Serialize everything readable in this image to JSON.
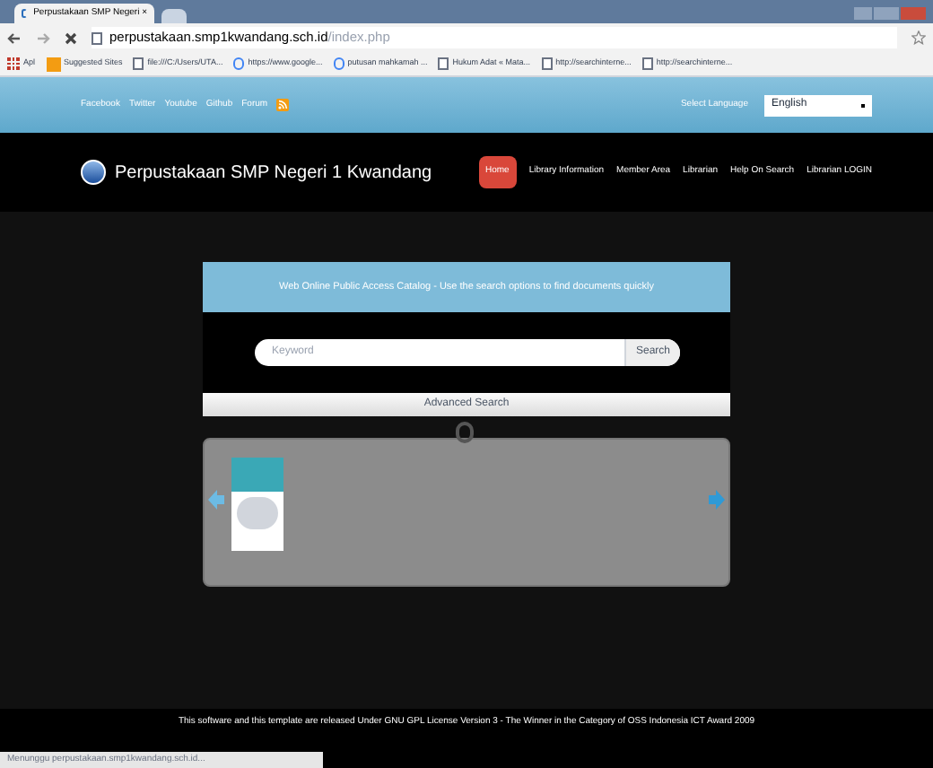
{
  "browser": {
    "tab_title": "Perpustakaan SMP Negeri ×",
    "url_host": "perpustakaan.smp1kwandang.sch.id",
    "url_path": "/index.php",
    "bookmarks": [
      {
        "kind": "apps",
        "label": "Apl"
      },
      {
        "kind": "suggested",
        "label": "Suggested Sites"
      },
      {
        "kind": "page",
        "label": "file:///C:/Users/UTA..."
      },
      {
        "kind": "google",
        "label": "https://www.google..."
      },
      {
        "kind": "google",
        "label": "putusan mahkamah ..."
      },
      {
        "kind": "page",
        "label": "Hukum Adat « Mata..."
      },
      {
        "kind": "page",
        "label": "http://searchinterne..."
      },
      {
        "kind": "page",
        "label": "http://searchinterne..."
      }
    ]
  },
  "topbar": {
    "links": [
      "Facebook",
      "Twitter",
      "Youtube",
      "Github",
      "Forum"
    ],
    "language_label": "Select Language",
    "language_value": "English"
  },
  "header": {
    "site_title": "Perpustakaan SMP Negeri 1 Kwandang",
    "nav": [
      {
        "label": "Home",
        "selected": true
      },
      {
        "label": "Library Information",
        "selected": false
      },
      {
        "label": "Member Area",
        "selected": false
      },
      {
        "label": "Librarian",
        "selected": false
      },
      {
        "label": "Help On Search",
        "selected": false
      },
      {
        "label": "Librarian LOGIN",
        "selected": false
      }
    ]
  },
  "search": {
    "banner": "Web Online Public Access Catalog - Use the search options to find documents quickly",
    "placeholder": "Keyword",
    "button": "Search",
    "advanced": "Advanced Search"
  },
  "footer": {
    "text": "This software and this template are released Under GNU GPL License Version 3 - The Winner in the Category of OSS Indonesia ICT Award 2009"
  },
  "status_bar": {
    "text": "Menunggu perpustakaan.smp1kwandang.sch.id..."
  }
}
